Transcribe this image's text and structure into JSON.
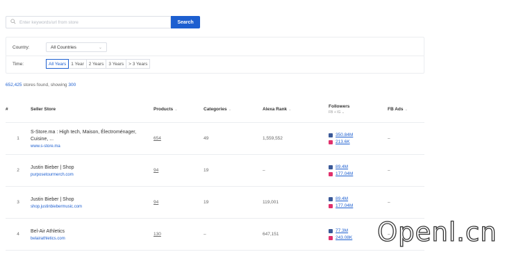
{
  "search": {
    "placeholder": "Enter keywords/url from store",
    "button_label": "Search"
  },
  "filters": {
    "country_label": "Country:",
    "country_value": "All Countries",
    "time_label": "Time:",
    "time_options": [
      "All Years",
      "1 Year",
      "2 Years",
      "3 Years",
      "> 3 Years"
    ],
    "time_selected": "All Years"
  },
  "results": {
    "count": "652,425",
    "text": "stores found, showing",
    "showing": "300"
  },
  "table": {
    "headers": {
      "index": "#",
      "store": "Seller Store",
      "products": "Products",
      "categories": "Categories",
      "alexa": "Alexa Rank",
      "followers": "Followers",
      "followers_sub": "FB + IG",
      "fb_ads": "FB Ads"
    },
    "rows": [
      {
        "index": "1",
        "name": "S-Store.ma : High tech, Maison, Électroménager, Cuisine, ...",
        "url": "www.s-store.ma",
        "products": "654",
        "categories": "49",
        "alexa": "1,559,552",
        "fb": "350.84M",
        "ig": "213.6K",
        "fb_ads": "–"
      },
      {
        "index": "2",
        "name": "Justin Bieber | Shop",
        "url": "purposetourmerch.com",
        "products": "94",
        "categories": "19",
        "alexa": "–",
        "fb": "89.4M",
        "ig": "177.04M",
        "fb_ads": "–"
      },
      {
        "index": "3",
        "name": "Justin Bieber | Shop",
        "url": "shop.justinbiebermusic.com",
        "products": "94",
        "categories": "19",
        "alexa": "119,001",
        "fb": "89.4M",
        "ig": "177.04M",
        "fb_ads": "–"
      },
      {
        "index": "4",
        "name": "Bel-Air Athletics",
        "url": "belairathletics.com",
        "products": "130",
        "categories": "–",
        "alexa": "647,151",
        "fb": "77.3M",
        "ig": "243.08K",
        "fb_ads": "–"
      }
    ]
  },
  "watermark": "Openl.cn",
  "icons": {
    "search": "search-icon",
    "facebook": "facebook-icon",
    "instagram": "instagram-icon",
    "sort": "sort-caret-icon",
    "chevron": "chevron-down-icon"
  },
  "colors": {
    "accent": "#1d5fd0",
    "facebook": "#3b5998",
    "instagram": "#e1306c"
  }
}
